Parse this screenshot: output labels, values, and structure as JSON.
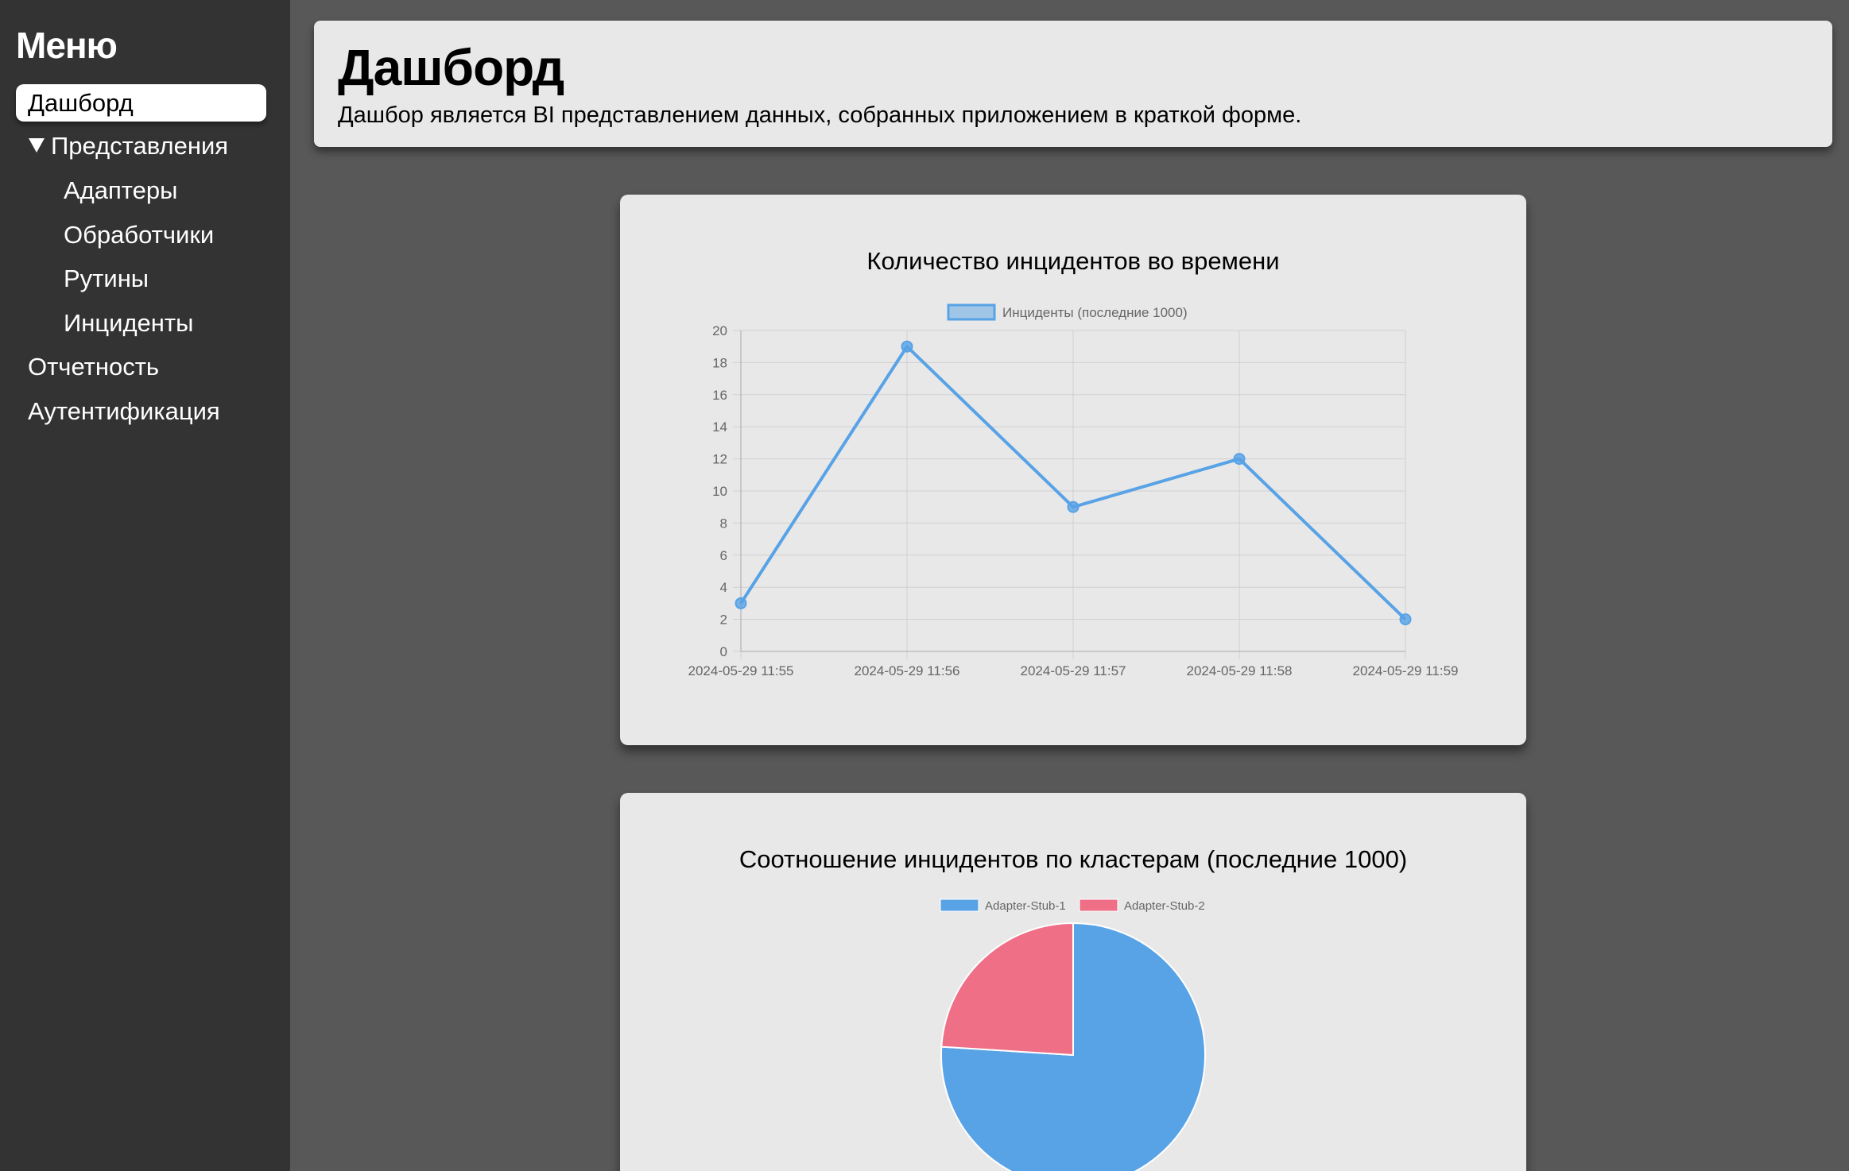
{
  "sidebar": {
    "title": "Меню",
    "items": [
      {
        "label": "Дашборд"
      },
      {
        "label": "Представления"
      },
      {
        "label": "Адаптеры"
      },
      {
        "label": "Обработчики"
      },
      {
        "label": "Рутины"
      },
      {
        "label": "Инциденты"
      },
      {
        "label": "Отчетность"
      },
      {
        "label": "Аутентификация"
      }
    ]
  },
  "header": {
    "title": "Дашборд",
    "description": "Дашбор является BI представлением данных, собранных приложением в краткой форме."
  },
  "colors": {
    "sidebar_bg": "#333333",
    "page_bg": "#585858",
    "card_bg": "#e8e8e8",
    "series_blue": "#58a2e6",
    "series_pink": "#ee6f86"
  },
  "chart_data": [
    {
      "type": "line",
      "title": "Количество инцидентов во времени",
      "x": [
        "2024-05-29 11:55",
        "2024-05-29 11:56",
        "2024-05-29 11:57",
        "2024-05-29 11:58",
        "2024-05-29 11:59"
      ],
      "series": [
        {
          "name": "Инциденты (последние 1000)",
          "values": [
            3,
            19,
            9,
            12,
            2
          ]
        }
      ],
      "ylim": [
        0,
        20
      ],
      "yticks": [
        0,
        2,
        4,
        6,
        8,
        10,
        12,
        14,
        16,
        18,
        20
      ],
      "grid": true,
      "legend": "top"
    },
    {
      "type": "pie",
      "title": "Соотношение инцидентов по кластерам (последние 1000)",
      "categories": [
        "Adapter-Stub-1",
        "Adapter-Stub-2"
      ],
      "values": [
        76,
        24
      ],
      "legend": "top"
    }
  ]
}
